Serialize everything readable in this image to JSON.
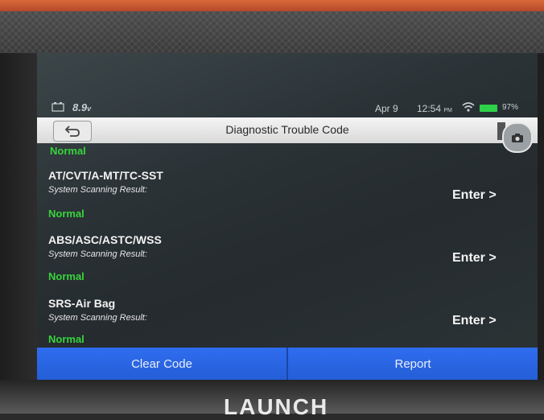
{
  "status_bar": {
    "voltage": "8.9",
    "voltage_unit": "v",
    "date": "Apr 9",
    "time": "12:54",
    "time_suffix": "PM",
    "battery_pct": "97%"
  },
  "header": {
    "title": "Diagnostic Trouble Code"
  },
  "systems": [
    {
      "name": "",
      "scan_label": "",
      "status": "Normal",
      "action": ""
    },
    {
      "name": "AT/CVT/A-MT/TC-SST",
      "scan_label": "System Scanning Result:",
      "status": "Normal",
      "action": "Enter >"
    },
    {
      "name": "ABS/ASC/ASTC/WSS",
      "scan_label": "System Scanning Result:",
      "status": "Normal",
      "action": "Enter >"
    },
    {
      "name": "SRS-Air Bag",
      "scan_label": "System Scanning Result:",
      "status": "Normal",
      "action": "Enter >"
    }
  ],
  "actions": {
    "clear_code": "Clear Code",
    "report": "Report"
  },
  "device": {
    "brand": "LAUNCH"
  },
  "colors": {
    "accent_blue": "#2f6df0",
    "status_green": "#37d43c",
    "device_orange": "#d9683a"
  }
}
